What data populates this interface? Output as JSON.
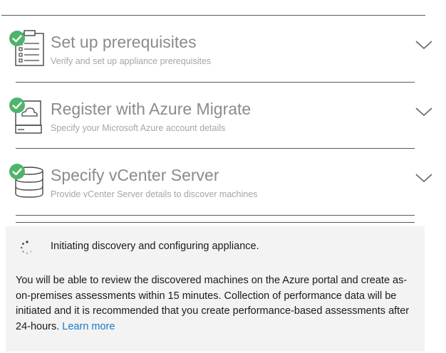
{
  "steps": [
    {
      "title": "Set up prerequisites",
      "subtitle": "Verify and set up appliance prerequisites",
      "icon": "clipboard-checklist-icon",
      "status": "complete"
    },
    {
      "title": "Register with Azure Migrate",
      "subtitle": "Specify your Microsoft Azure account details",
      "icon": "cloud-drive-icon",
      "status": "complete"
    },
    {
      "title": "Specify vCenter Server",
      "subtitle": "Provide vCenter Server details to discover machines",
      "icon": "database-icon",
      "status": "complete"
    }
  ],
  "discovery": {
    "status": "Initiating discovery and configuring appliance.",
    "message": "You will be able to review the discovered machines on the Azure portal and create as-on-premises assessments within 15 minutes. Collection of performance data will be initiated and it is recommended that you create performance-based assessments after 24-hours.",
    "link": "Learn more"
  },
  "colors": {
    "check": "#4fb46a",
    "link": "#1b79c7",
    "panel": "#f3f3f3",
    "title": "#8b8b8b"
  }
}
